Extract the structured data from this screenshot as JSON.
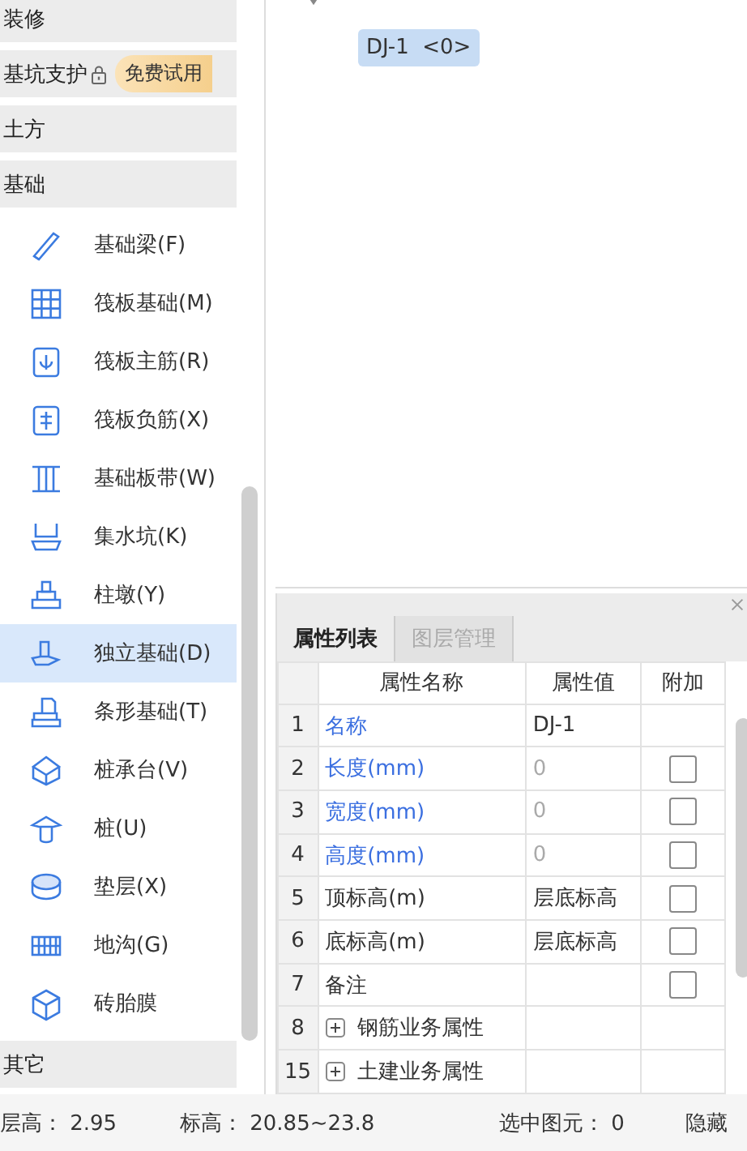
{
  "sidebar": {
    "groups": [
      {
        "label": "装修"
      },
      {
        "label": "基坑支护",
        "locked": true,
        "badge": "免费试用"
      },
      {
        "label": "土方"
      },
      {
        "label": "基础",
        "items": [
          {
            "label": "基础梁(F)",
            "selected": false
          },
          {
            "label": "筏板基础(M)",
            "selected": false
          },
          {
            "label": "筏板主筋(R)",
            "selected": false
          },
          {
            "label": "筏板负筋(X)",
            "selected": false
          },
          {
            "label": "基础板带(W)",
            "selected": false
          },
          {
            "label": "集水坑(K)",
            "selected": false
          },
          {
            "label": "柱墩(Y)",
            "selected": false
          },
          {
            "label": "独立基础(D)",
            "selected": true
          },
          {
            "label": "条形基础(T)",
            "selected": false
          },
          {
            "label": "桩承台(V)",
            "selected": false
          },
          {
            "label": "桩(U)",
            "selected": false
          },
          {
            "label": "垫层(X)",
            "selected": false
          },
          {
            "label": "地沟(G)",
            "selected": false
          },
          {
            "label": "砖胎膜",
            "selected": false
          }
        ]
      },
      {
        "label": "其它"
      }
    ]
  },
  "tree": {
    "expanded": true,
    "children": [
      {
        "label": "DJ-1  <0>",
        "selected": true
      }
    ]
  },
  "properties": {
    "tabs": [
      {
        "label": "属性列表",
        "selected": true
      },
      {
        "label": "图层管理",
        "selected": false
      }
    ],
    "columns": [
      "属性名称",
      "属性值",
      "附加"
    ],
    "rows": [
      {
        "num": "1",
        "name": "名称",
        "kind": "public",
        "value": "DJ-1"
      },
      {
        "num": "2",
        "name": "长度(mm)",
        "kind": "public",
        "value": "0",
        "value_disabled": true,
        "checked": false
      },
      {
        "num": "3",
        "name": "宽度(mm)",
        "kind": "public",
        "value": "0",
        "value_disabled": true,
        "checked": false
      },
      {
        "num": "4",
        "name": "高度(mm)",
        "kind": "public",
        "value": "0",
        "value_disabled": true,
        "checked": false
      },
      {
        "num": "5",
        "name": "顶标高(m)",
        "kind": "private",
        "value": "层底标高",
        "checked": false
      },
      {
        "num": "6",
        "name": "底标高(m)",
        "kind": "private",
        "value": "层底标高",
        "checked": false
      },
      {
        "num": "7",
        "name": "备注",
        "kind": "private",
        "checked": false
      },
      {
        "num": "8",
        "name": "钢筋业务属性",
        "kind": "group",
        "expanded": false
      },
      {
        "num": "15",
        "name": "土建业务属性",
        "kind": "group",
        "expanded": false
      }
    ]
  },
  "status_bar": [
    {
      "label": "层高：",
      "value": "2.95"
    },
    {
      "label": "标高：",
      "value": "20.85~23.8"
    },
    {
      "label": "选中图元：",
      "value": "0"
    },
    {
      "label": "隐藏"
    }
  ]
}
